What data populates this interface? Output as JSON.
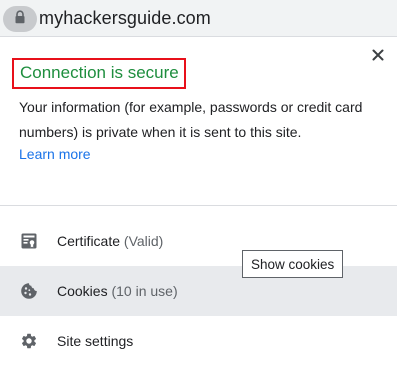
{
  "address_bar": {
    "url": "myhackersguide.com",
    "icon": "lock-icon"
  },
  "popup": {
    "title": "Connection is secure",
    "title_color": "#1e8e3e",
    "highlight_color": "#e8101a",
    "description": "Your information (for example, passwords or credit card numbers) is private when it is sent to this site.",
    "learn_more": "Learn more",
    "close_icon": "close-icon",
    "items": [
      {
        "label": "Certificate",
        "status": "(Valid)",
        "icon": "certificate-icon"
      },
      {
        "label": "Cookies",
        "status": "(10 in use)",
        "icon": "cookie-icon"
      },
      {
        "label": "Site settings",
        "status": "",
        "icon": "gear-icon"
      }
    ],
    "tooltip": "Show cookies"
  }
}
